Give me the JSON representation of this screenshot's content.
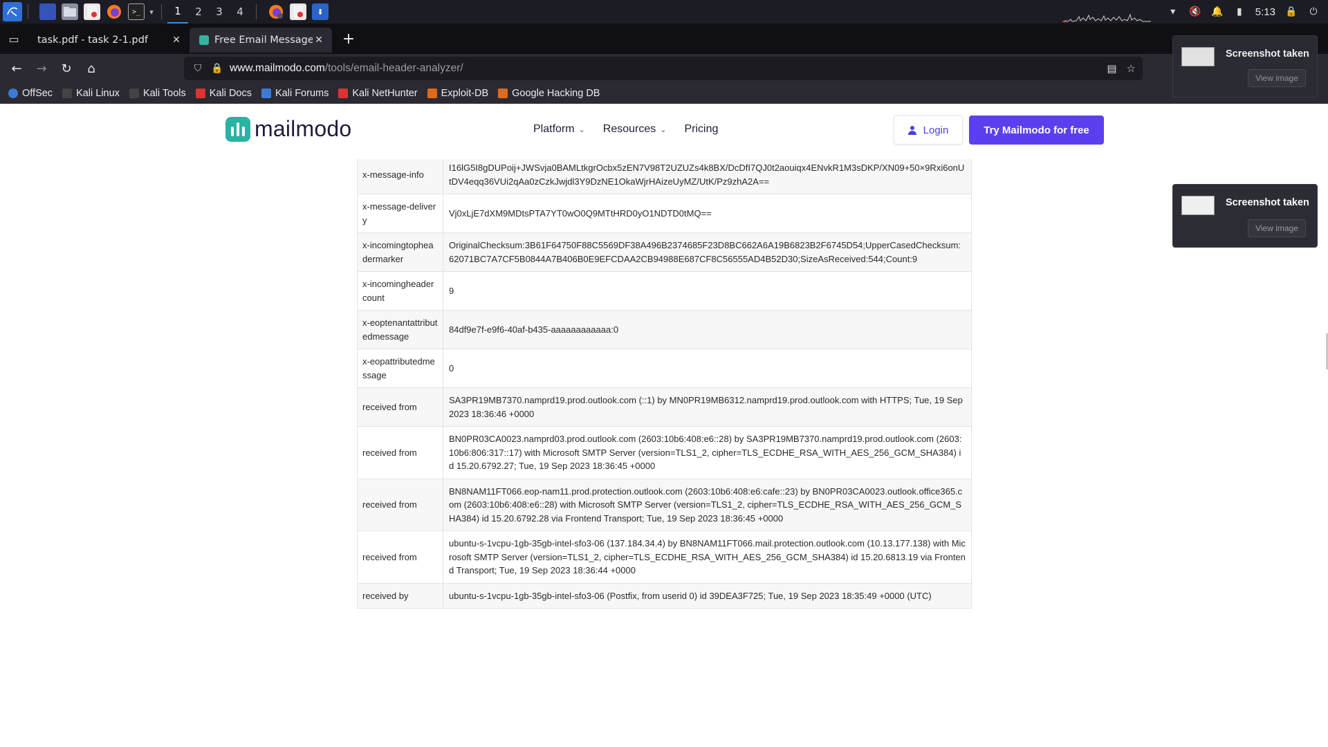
{
  "taskbar": {
    "workspaces": [
      "1",
      "2",
      "3",
      "4"
    ],
    "clock": "5:13",
    "icons": [
      "kali-menu-icon",
      "desktop-icon",
      "file-manager-icon",
      "document-icon",
      "firefox-icon",
      "terminal-icon"
    ]
  },
  "browser": {
    "tabs": [
      {
        "title": "task.pdf - task 2-1.pdf",
        "active": false
      },
      {
        "title": "Free Email Message Head",
        "active": true
      }
    ],
    "url": {
      "host": "www.mailmodo.com",
      "path": "/tools/email-header-analyzer/"
    },
    "bookmarks": [
      {
        "label": "OffSec",
        "color": "#3b7bd6"
      },
      {
        "label": "Kali Linux",
        "color": "#333"
      },
      {
        "label": "Kali Tools",
        "color": "#333"
      },
      {
        "label": "Kali Docs",
        "color": "#d33"
      },
      {
        "label": "Kali Forums",
        "color": "#3b7bd6"
      },
      {
        "label": "Kali NetHunter",
        "color": "#d33"
      },
      {
        "label": "Exploit-DB",
        "color": "#e06a1b"
      },
      {
        "label": "Google Hacking DB",
        "color": "#e06a1b"
      }
    ]
  },
  "site": {
    "logo_text": "mailmodo",
    "nav": [
      {
        "label": "Platform",
        "dropdown": true
      },
      {
        "label": "Resources",
        "dropdown": true
      },
      {
        "label": "Pricing",
        "dropdown": false
      }
    ],
    "login_label": "Login",
    "cta_label": "Try Mailmodo for free",
    "accent_color": "#5b3fef"
  },
  "headers_table": [
    {
      "key": "x-message-info",
      "value": "I16lG5I8gDUPoij+JWSvja0BAMLtkgrOcbx5zEN7V98T2UZUZs4k8BX/DcDfI7QJ0t2aouiqx4ENvkR1M3sDKP/XN09+50×9Rxi6onUtDV4eqq36VUi2qAa0zCzkJwjdl3Y9DzNE1OkaWjrHAizeUyMZ/UtK/Pz9zhA2A=="
    },
    {
      "key": "x-message-delivery",
      "value": "Vj0xLjE7dXM9MDtsPTA7YT0wO0Q9MTtHRD0yO1NDTD0tMQ=="
    },
    {
      "key": "x-incomingtopheadermarker",
      "value": "OriginalChecksum:3B61F64750F88C5569DF38A496B2374685F23D8BC662A6A19B6823B2F6745D54;UpperCasedChecksum:62071BC7A7CF5B0844A7B406B0E9EFCDAA2CB94988E687CF8C56555AD4B52D30;SizeAsReceived:544;Count:9"
    },
    {
      "key": "x-incomingheadercount",
      "value": "9"
    },
    {
      "key": "x-eoptenantattributedmessage",
      "value": "84df9e7f-e9f6-40af-b435-aaaaaaaaaaaa:0"
    },
    {
      "key": "x-eopattributedmessage",
      "value": "0"
    },
    {
      "key": "received from",
      "value": "SA3PR19MB7370.namprd19.prod.outlook.com (::1) by MN0PR19MB6312.namprd19.prod.outlook.com with HTTPS; Tue, 19 Sep 2023 18:36:46 +0000"
    },
    {
      "key": "received from",
      "value": "BN0PR03CA0023.namprd03.prod.outlook.com (2603:10b6:408:e6::28) by SA3PR19MB7370.namprd19.prod.outlook.com (2603:10b6:806:317::17) with Microsoft SMTP Server (version=TLS1_2, cipher=TLS_ECDHE_RSA_WITH_AES_256_GCM_SHA384) id 15.20.6792.27; Tue, 19 Sep 2023 18:36:45 +0000"
    },
    {
      "key": "received from",
      "value": "BN8NAM11FT066.eop-nam11.prod.protection.outlook.com (2603:10b6:408:e6:cafe::23) by BN0PR03CA0023.outlook.office365.com (2603:10b6:408:e6::28) with Microsoft SMTP Server (version=TLS1_2, cipher=TLS_ECDHE_RSA_WITH_AES_256_GCM_SHA384) id 15.20.6792.28 via Frontend Transport; Tue, 19 Sep 2023 18:36:45 +0000"
    },
    {
      "key": "received from",
      "value": "ubuntu-s-1vcpu-1gb-35gb-intel-sfo3-06 (137.184.34.4) by BN8NAM11FT066.mail.protection.outlook.com (10.13.177.138) with Microsoft SMTP Server (version=TLS1_2, cipher=TLS_ECDHE_RSA_WITH_AES_256_GCM_SHA384) id 15.20.6813.19 via Frontend Transport; Tue, 19 Sep 2023 18:36:44 +0000"
    },
    {
      "key": "received by",
      "value": "ubuntu-s-1vcpu-1gb-35gb-intel-sfo3-06 (Postfix, from userid 0) id 39DEA3F725; Tue, 19 Sep 2023 18:35:49 +0000 (UTC)"
    }
  ],
  "notifications": [
    {
      "title": "Screenshot taken",
      "button": "View image"
    },
    {
      "title": "Screenshot taken",
      "button": "View image"
    }
  ]
}
